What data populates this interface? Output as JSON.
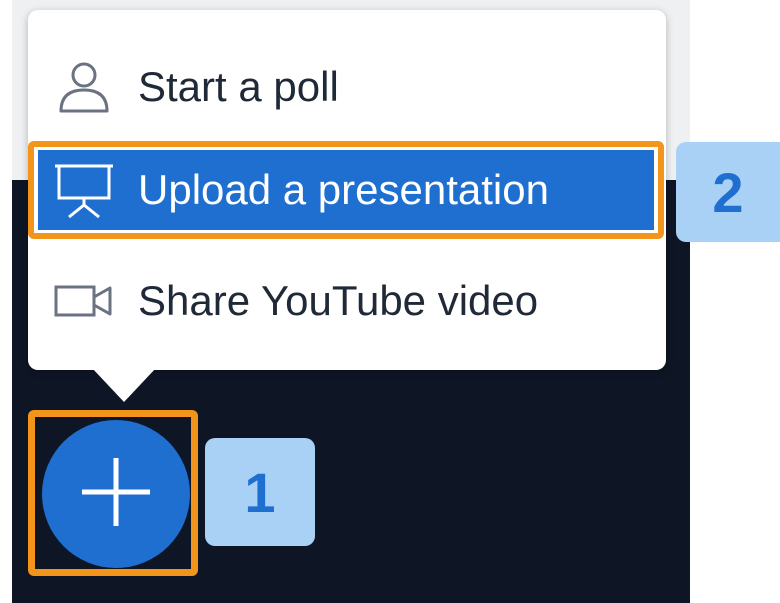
{
  "menu": {
    "items": [
      {
        "label": "Start a poll",
        "icon": "user-icon"
      },
      {
        "label": "Upload a presentation",
        "icon": "presentation-icon"
      },
      {
        "label": "Share YouTube video",
        "icon": "video-camera-icon"
      }
    ]
  },
  "callouts": {
    "step1": "1",
    "step2": "2"
  },
  "action_button": {
    "icon": "plus-icon"
  },
  "colors": {
    "accent": "#1f6fd1",
    "highlight": "#f2951a",
    "badge_bg": "#a8d1f5",
    "dark_background": "#0e1525"
  }
}
